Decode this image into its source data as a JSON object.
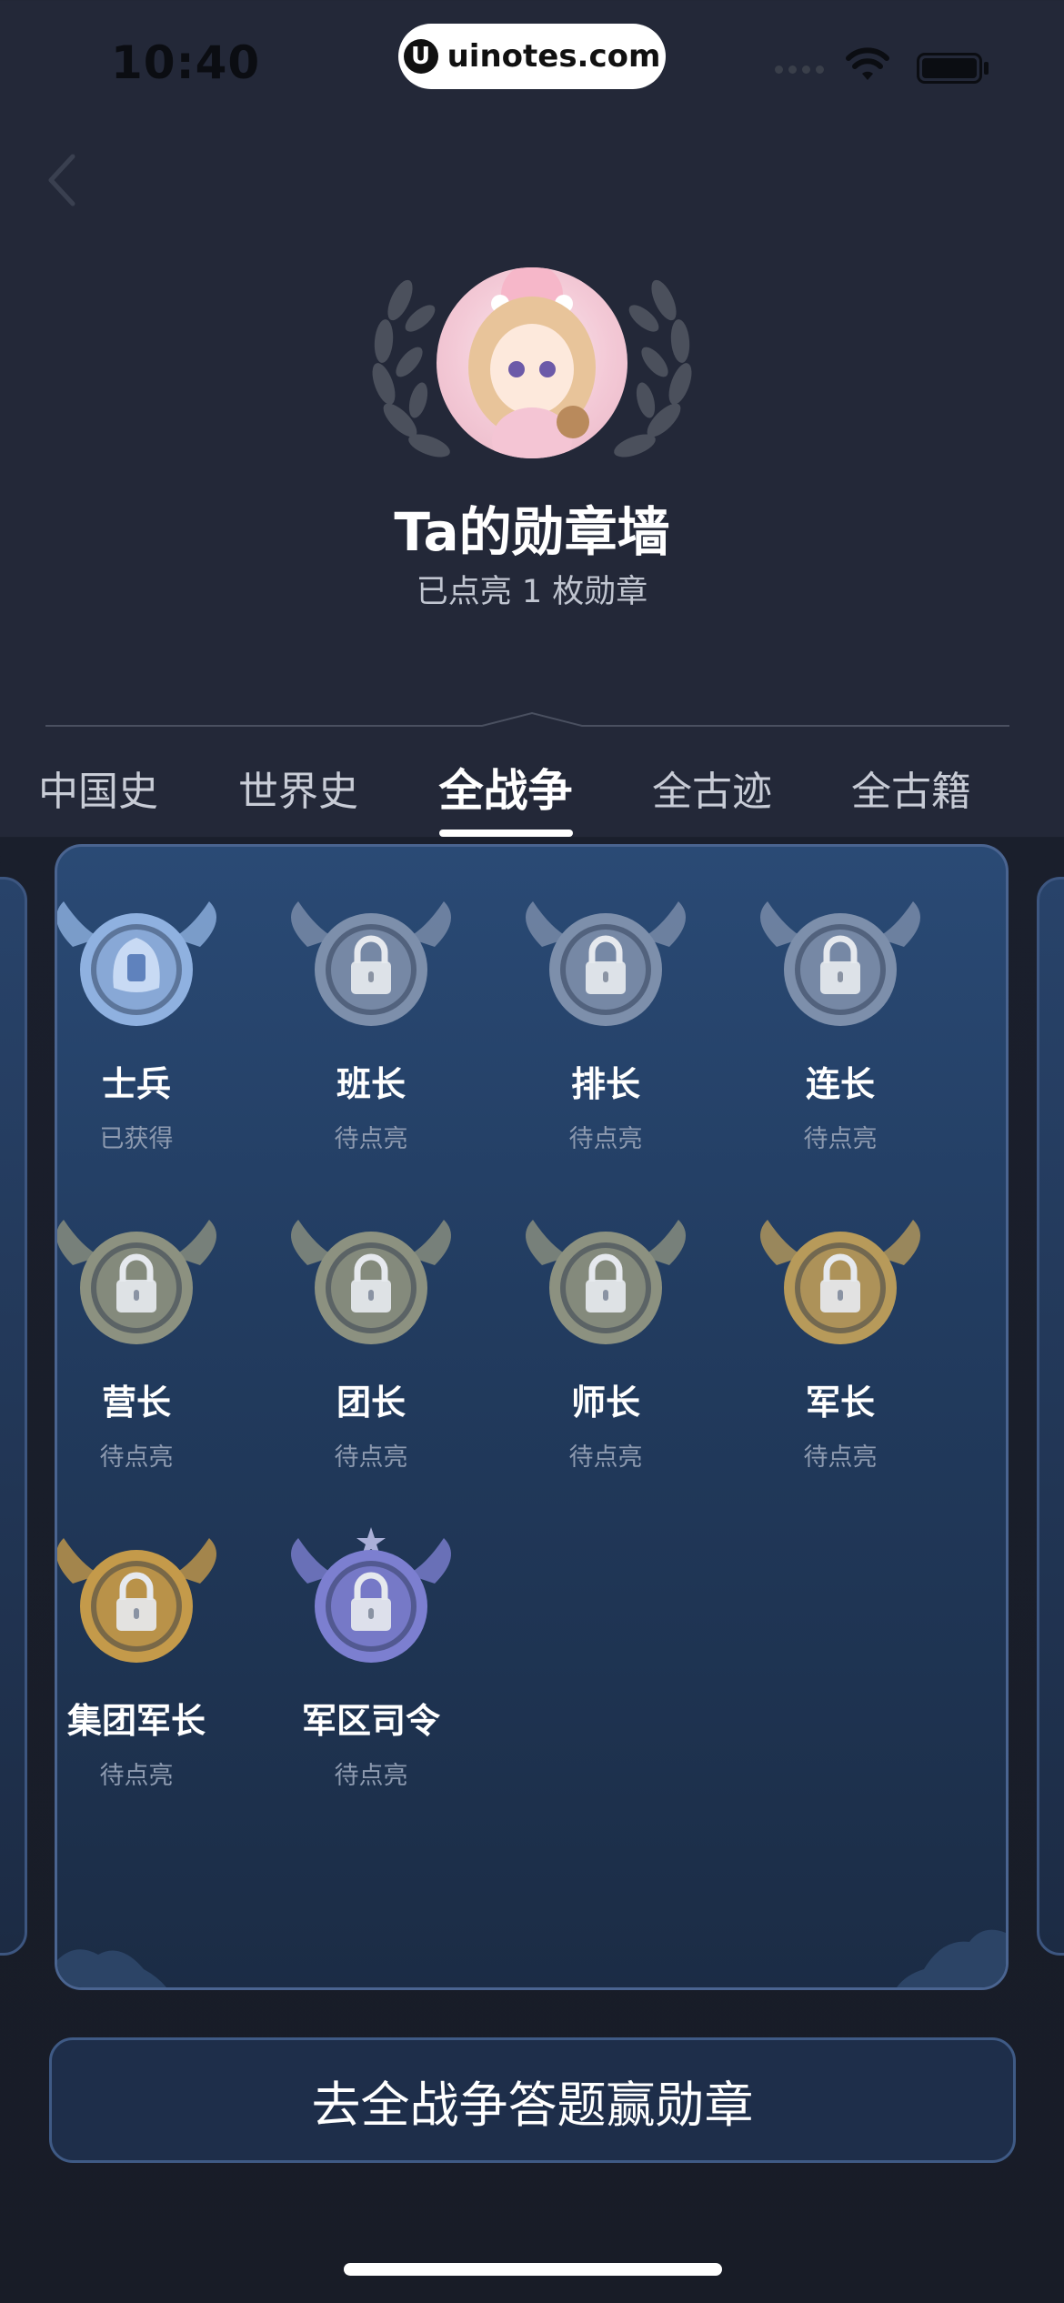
{
  "status_bar": {
    "time": "10:40",
    "site": "uinotes.com",
    "site_logo": "U"
  },
  "header": {
    "title": "Ta的勋章墙",
    "subtitle": "已点亮 1 枚勋章"
  },
  "tabs": [
    {
      "label": "中国史",
      "active": false
    },
    {
      "label": "世界史",
      "active": false
    },
    {
      "label": "全战争",
      "active": true
    },
    {
      "label": "全古迹",
      "active": false
    },
    {
      "label": "全古籍",
      "active": false
    }
  ],
  "badges": [
    {
      "name": "士兵",
      "status": "已获得",
      "icon": "soldier-helmet-icon",
      "color": "#8fb1e0",
      "locked": false
    },
    {
      "name": "班长",
      "status": "待点亮",
      "icon": "tank-icon",
      "color": "#7d8fab",
      "locked": true
    },
    {
      "name": "排长",
      "status": "待点亮",
      "icon": "shell-icon",
      "color": "#7d8fab",
      "locked": true
    },
    {
      "name": "连长",
      "status": "待点亮",
      "icon": "map-icon",
      "color": "#7d8fab",
      "locked": true
    },
    {
      "name": "营长",
      "status": "待点亮",
      "icon": "grenade-icon",
      "color": "#8c9180",
      "locked": true
    },
    {
      "name": "团长",
      "status": "待点亮",
      "icon": "radio-icon",
      "color": "#8c9180",
      "locked": true
    },
    {
      "name": "师长",
      "status": "待点亮",
      "icon": "letter-icon",
      "color": "#8c9180",
      "locked": true
    },
    {
      "name": "军长",
      "status": "待点亮",
      "icon": "star-crest-icon",
      "color": "#b79a5a",
      "locked": true
    },
    {
      "name": "集团军长",
      "status": "待点亮",
      "icon": "rocket-icon",
      "color": "#c49a4a",
      "locked": true
    },
    {
      "name": "军区司令",
      "status": "待点亮",
      "icon": "winged-trophy-icon",
      "color": "#7c7fd0",
      "locked": true
    }
  ],
  "cta": {
    "label": "去全战争答题赢勋章"
  },
  "colors": {
    "background": "#232838",
    "panel": "#223c60",
    "accent": "#ffffff"
  }
}
